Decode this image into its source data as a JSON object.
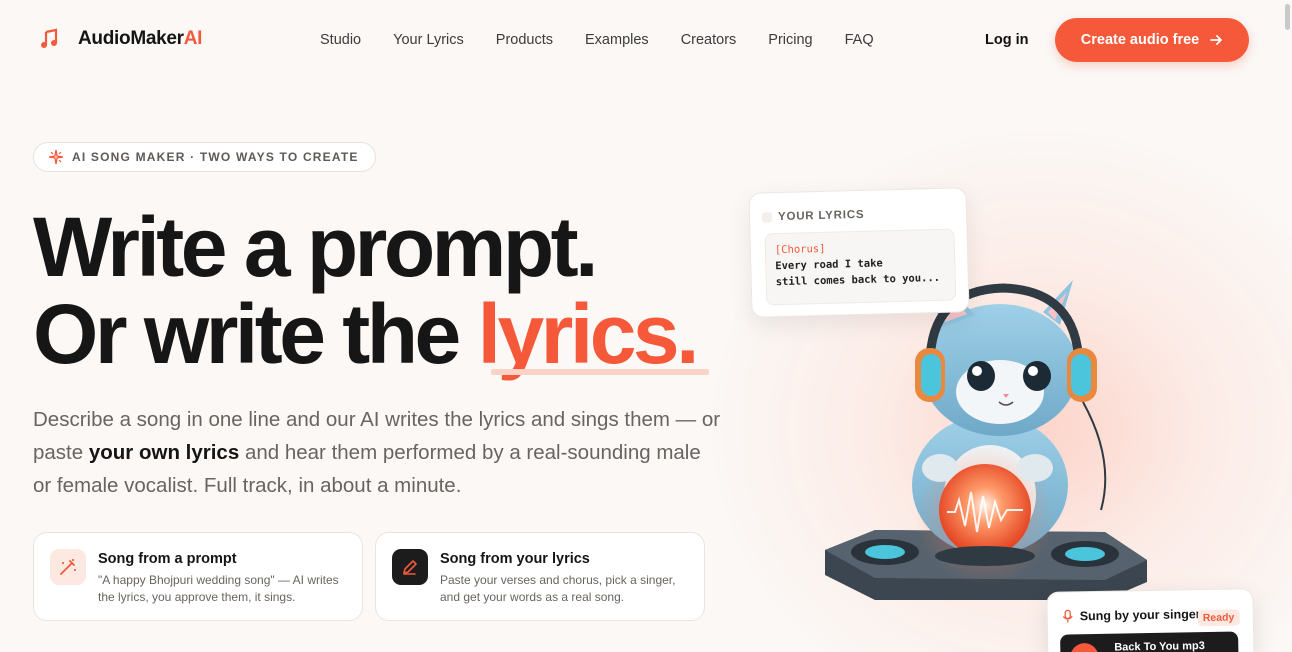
{
  "brand": {
    "name_main": "AudioMaker",
    "name_accent": "AI",
    "accent_color": "#f5593a",
    "icon": "music-note-icon"
  },
  "nav": {
    "links": [
      "Studio",
      "Your Lyrics",
      "Products",
      "Examples",
      "Creators",
      "Pricing",
      "FAQ"
    ],
    "login": "Log in",
    "cta": "Create audio free"
  },
  "hero": {
    "badge": "AI SONG MAKER · TWO WAYS TO CREATE",
    "headline_line1": "Write a prompt.",
    "headline_line2_prefix": "Or write the ",
    "headline_line2_accent": "lyrics.",
    "desc_part1": "Describe a song in one line and our AI writes the lyrics and sings them — or paste ",
    "desc_bold": "your own lyrics",
    "desc_part2": " and hear them performed by a real-sounding male or female vocalist. Full track, in about a minute."
  },
  "cards": [
    {
      "title": "Song from a prompt",
      "body": "\"A happy Bhojpuri wedding song\" — AI writes the lyrics, you approve them, it sings.",
      "icon": "magic-wand-icon"
    },
    {
      "title": "Song from your lyrics",
      "body": "Paste your verses and chorus, pick a singer, and get your words as a real song.",
      "icon": "pen-icon"
    }
  ],
  "lyrics_card": {
    "label": "YOUR LYRICS",
    "tag": "[Chorus]",
    "line1": "Every road I take",
    "line2": "still comes back to you..."
  },
  "singer_card": {
    "label": "Sung by your singer",
    "status": "Ready",
    "track": "Back To You mp3"
  }
}
